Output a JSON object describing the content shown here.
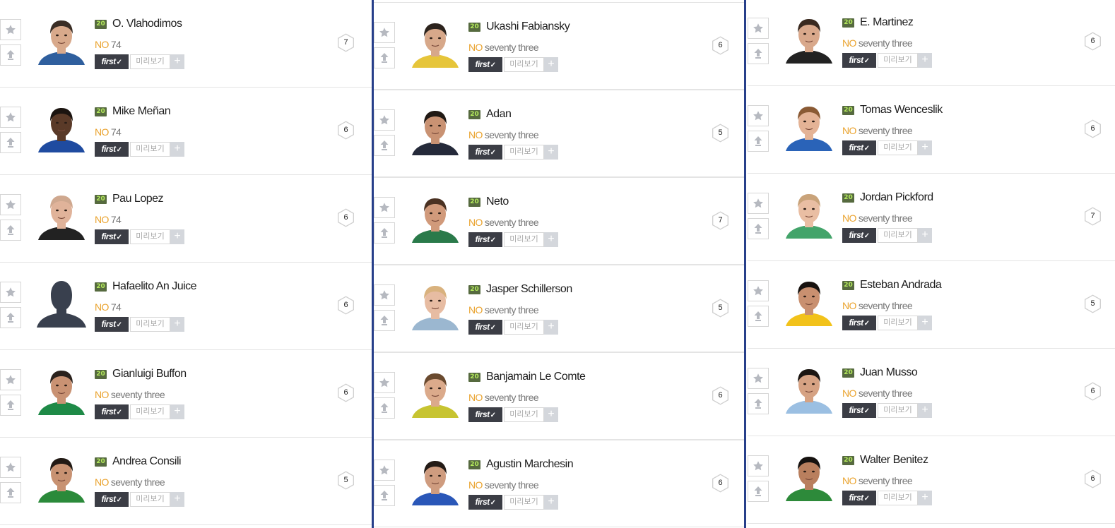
{
  "labels": {
    "first": "first",
    "first_check": "✓",
    "preview": "미리보기",
    "plus": "+"
  },
  "colors": {
    "divider": "#273f8a",
    "position": "#eaa32e",
    "badge_bg": "#566a3f",
    "badge_text": "#b4ea5c"
  },
  "icons": {
    "favorite": "star-icon",
    "upgrade": "arrow-up-icon",
    "silhouette": "silhouette-placeholder"
  },
  "columns": [
    {
      "players": [
        {
          "season": "20",
          "name": "O. Vlahodimos",
          "position": "NO",
          "ovr": "74",
          "grade": "7",
          "skin": "#d8a98b",
          "hair": "#3a2d25",
          "shirt": "#2f5f9e"
        },
        {
          "season": "20",
          "name": "Mike Meñan",
          "position": "NO",
          "ovr": "74",
          "grade": "6",
          "skin": "#5a3a28",
          "hair": "#1b1410",
          "shirt": "#1f4ba0"
        },
        {
          "season": "20",
          "name": "Pau Lopez",
          "position": "NO",
          "ovr": "74",
          "grade": "6",
          "skin": "#e0b39a",
          "hair": "#cfa88f",
          "shirt": "#222222"
        },
        {
          "season": "20",
          "name": "Hafaelito An Juice",
          "position": "NO",
          "ovr": "74",
          "grade": "6",
          "silhouette": true
        },
        {
          "season": "20",
          "name": "Gianluigi Buffon",
          "position": "NO",
          "ovr": "seventy three",
          "grade": "6",
          "skin": "#c99273",
          "hair": "#2a211c",
          "shirt": "#1e8a47"
        },
        {
          "season": "20",
          "name": "Andrea Consili",
          "position": "NO",
          "ovr": "seventy three",
          "grade": "5",
          "skin": "#c89272",
          "hair": "#221a15",
          "shirt": "#2b8a3a"
        }
      ]
    },
    {
      "players": [
        {
          "season": "20",
          "name": "Ukashi Fabiansky",
          "position": "NO",
          "ovr": "seventy three",
          "grade": "6",
          "skin": "#d7a88a",
          "hair": "#2c231d",
          "shirt": "#e6c53a"
        },
        {
          "season": "20",
          "name": "Adan",
          "position": "NO",
          "ovr": "seventy three",
          "grade": "5",
          "skin": "#c99273",
          "hair": "#201914",
          "shirt": "#252a3a"
        },
        {
          "season": "20",
          "name": "Neto",
          "position": "NO",
          "ovr": "seventy three",
          "grade": "7",
          "skin": "#d19a7b",
          "hair": "#4a3122",
          "shirt": "#2a7a4a"
        },
        {
          "season": "20",
          "name": "Jasper Schillerson",
          "position": "NO",
          "ovr": "seventy three",
          "grade": "5",
          "skin": "#e7bca2",
          "hair": "#d9b27e",
          "shirt": "#9bb7d0"
        },
        {
          "season": "20",
          "name": "Banjamain Le Comte",
          "position": "NO",
          "ovr": "seventy three",
          "grade": "6",
          "skin": "#dbaa8b",
          "hair": "#6a4a2f",
          "shirt": "#c7c431"
        },
        {
          "season": "20",
          "name": "Agustin Marchesin",
          "position": "NO",
          "ovr": "seventy three",
          "grade": "6",
          "skin": "#cf9c7f",
          "hair": "#231b16",
          "shirt": "#2a57b8"
        }
      ]
    },
    {
      "players": [
        {
          "season": "20",
          "name": "E. Martinez",
          "position": "NO",
          "ovr": "seventy three",
          "grade": "6",
          "skin": "#d9a88b",
          "hair": "#3a2a20",
          "shirt": "#222222"
        },
        {
          "season": "20",
          "name": "Tomas Wenceslik",
          "position": "NO",
          "ovr": "seventy three",
          "grade": "6",
          "skin": "#e4b396",
          "hair": "#8a5a34",
          "shirt": "#2a63b8"
        },
        {
          "season": "20",
          "name": "Jordan Pickford",
          "position": "NO",
          "ovr": "seventy three",
          "grade": "7",
          "skin": "#e9bea3",
          "hair": "#c9a37a",
          "shirt": "#43a46a"
        },
        {
          "season": "20",
          "name": "Esteban Andrada",
          "position": "NO",
          "ovr": "seventy three",
          "grade": "5",
          "skin": "#c99070",
          "hair": "#181310",
          "shirt": "#f2c21a"
        },
        {
          "season": "20",
          "name": "Juan Musso",
          "position": "NO",
          "ovr": "seventy three",
          "grade": "6",
          "skin": "#d6a283",
          "hair": "#1c1612",
          "shirt": "#9bbfe2"
        },
        {
          "season": "20",
          "name": "Walter Benitez",
          "position": "NO",
          "ovr": "seventy three",
          "grade": "6",
          "skin": "#b97f5e",
          "hair": "#161210",
          "shirt": "#2d8a3a"
        }
      ]
    }
  ]
}
